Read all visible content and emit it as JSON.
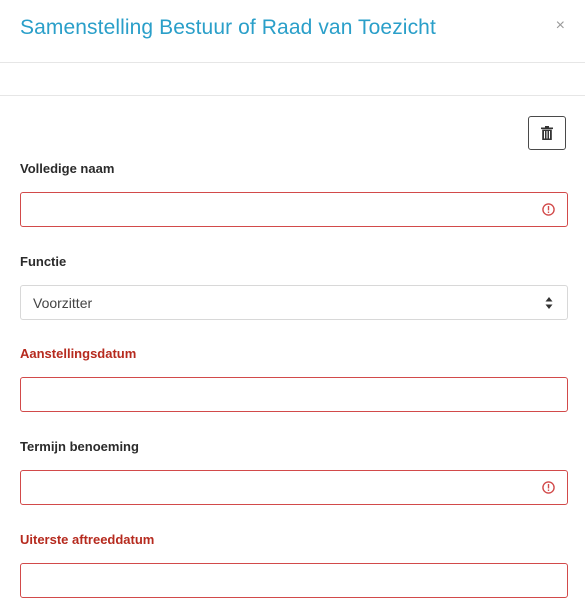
{
  "dialog": {
    "title": "Samenstelling Bestuur of Raad van Toezicht",
    "close_label": "×"
  },
  "toolbar": {
    "delete_icon": "trash-icon"
  },
  "fields": {
    "full_name": {
      "label": "Volledige naam",
      "value": "",
      "status": "error"
    },
    "function": {
      "label": "Functie",
      "selected": "Voorzitter"
    },
    "appointment_date": {
      "label": "Aanstellingsdatum",
      "value": "",
      "required": true
    },
    "term": {
      "label": "Termijn benoeming",
      "value": "",
      "status": "error"
    },
    "retirement_date": {
      "label": "Uiterste aftreeddatum",
      "value": "",
      "required": true
    }
  },
  "colors": {
    "title": "#2a9fc9",
    "required_label": "#b62a1e",
    "error_border": "#d24a4a"
  }
}
